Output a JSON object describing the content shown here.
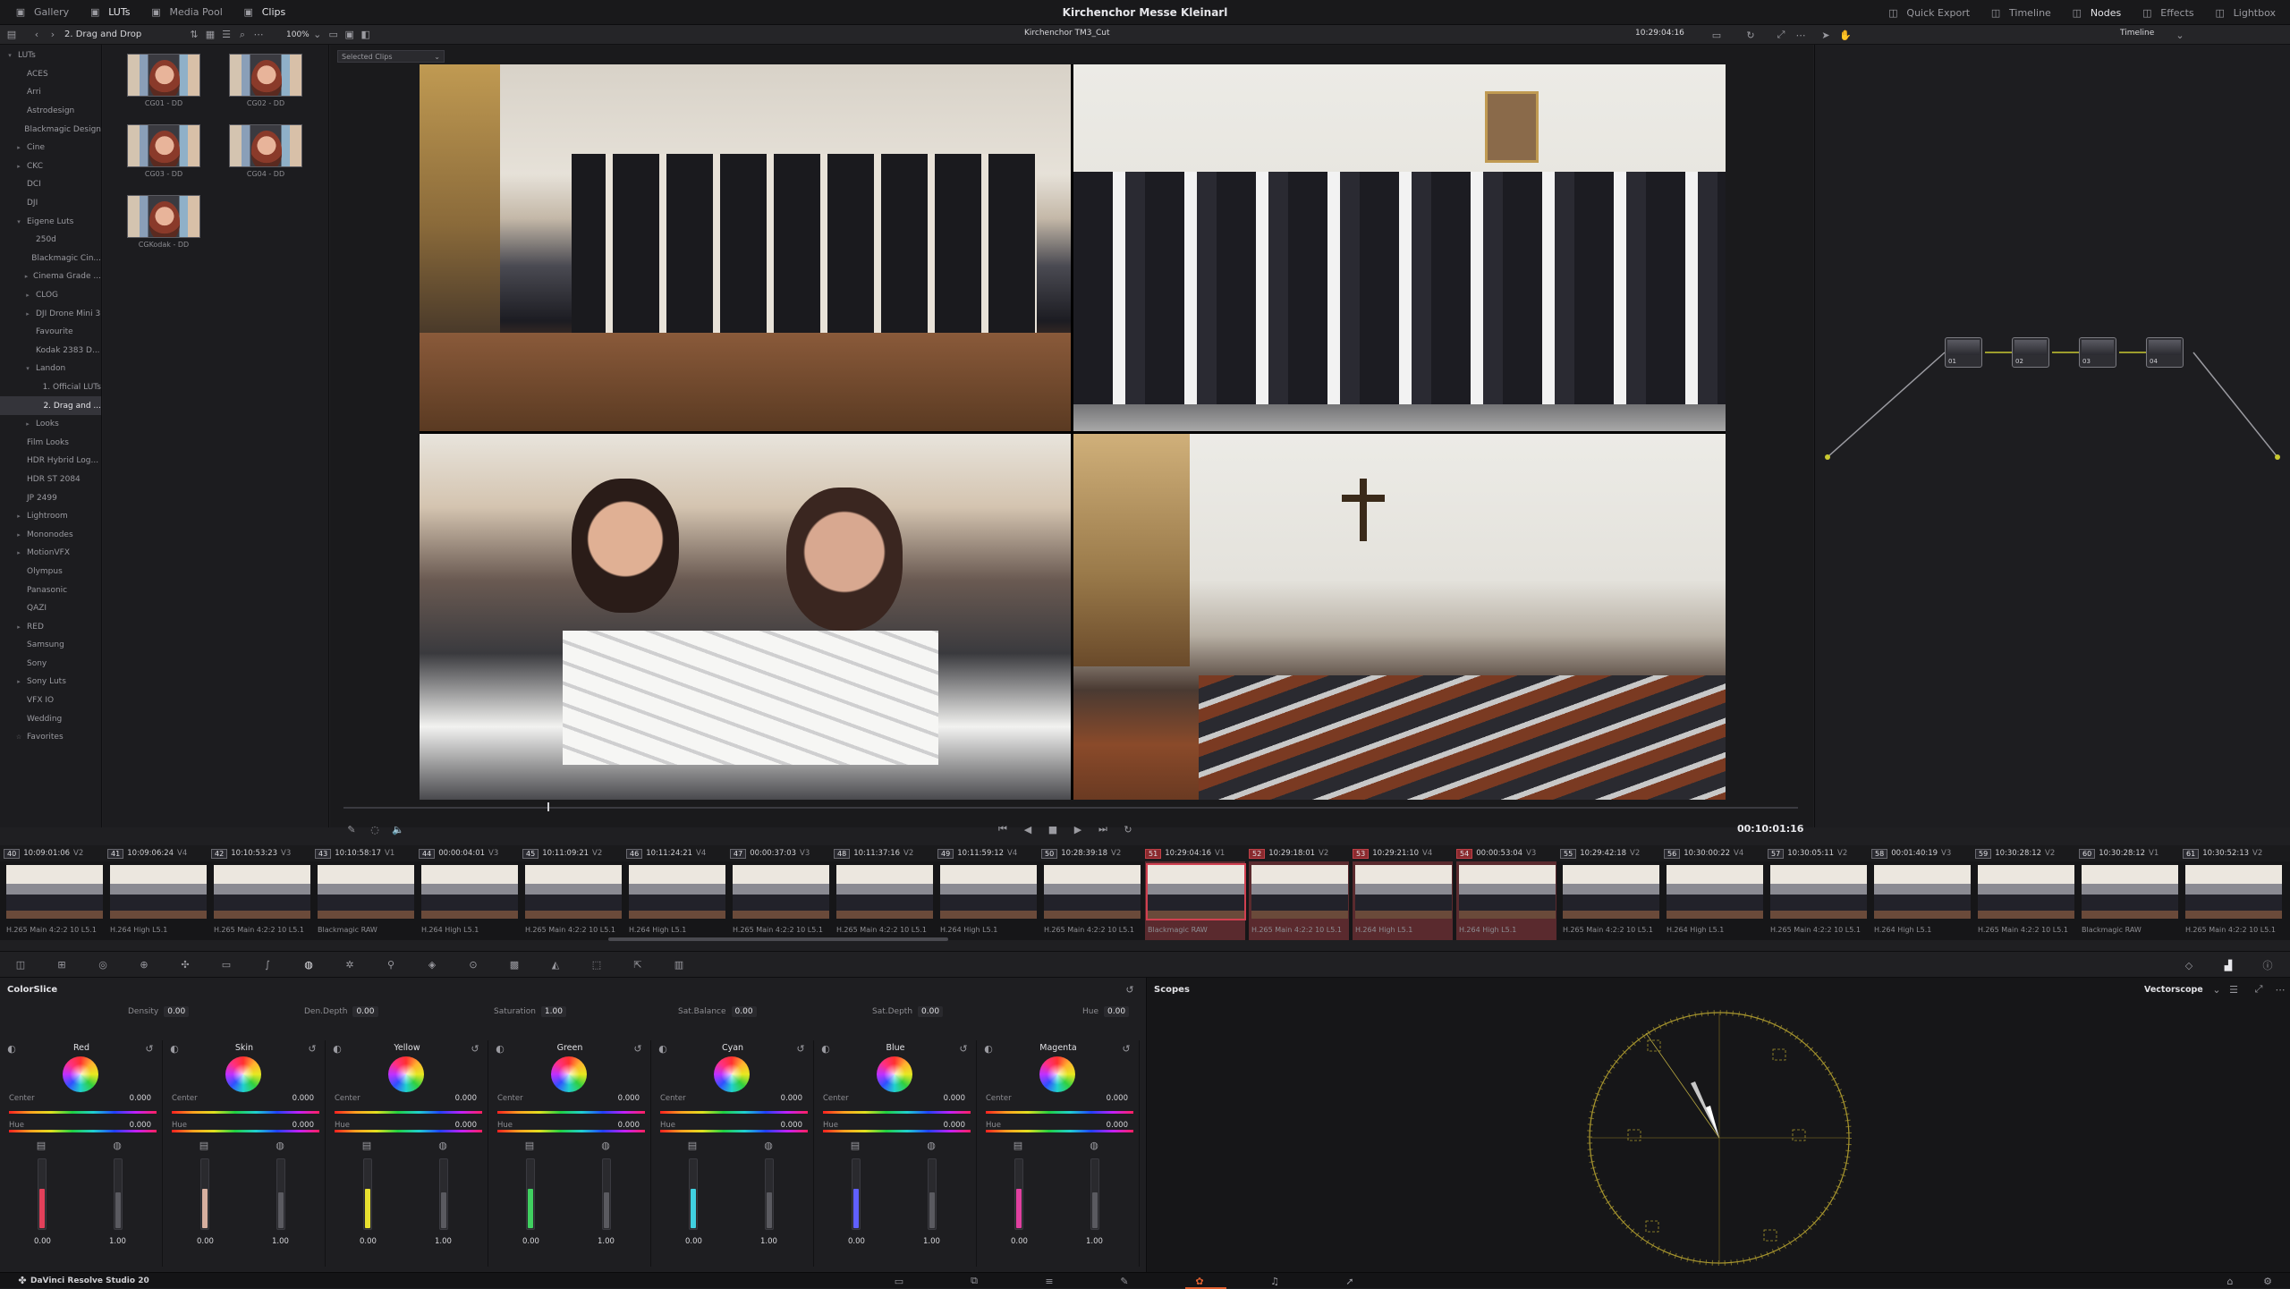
{
  "topbar": {
    "tabs": [
      {
        "label": "Gallery",
        "icon": "gallery-icon"
      },
      {
        "label": "LUTs",
        "icon": "luts-icon"
      },
      {
        "label": "Media Pool",
        "icon": "media-pool-icon"
      },
      {
        "label": "Clips",
        "icon": "clips-icon"
      }
    ],
    "project_title": "Kirchenchor Messe Kleinarl",
    "right_tabs": [
      {
        "label": "Quick Export"
      },
      {
        "label": "Timeline"
      },
      {
        "label": "Nodes"
      },
      {
        "label": "Effects"
      },
      {
        "label": "Lightbox"
      }
    ]
  },
  "toolbar2": {
    "lut_folder": "2. Drag and Drop",
    "zoom": "100%",
    "timeline_name": "Kirchenchor TM3_Cut",
    "timecode": "10:29:04:16",
    "node_mode": "Timeline",
    "selected_clips": "Selected Clips"
  },
  "sidebar": {
    "items": [
      {
        "label": "LUTs",
        "level": 0,
        "arrow": "v"
      },
      {
        "label": "ACES",
        "level": 1,
        "arrow": ""
      },
      {
        "label": "Arri",
        "level": 1,
        "arrow": ""
      },
      {
        "label": "Astrodesign",
        "level": 1,
        "arrow": ""
      },
      {
        "label": "Blackmagic Design",
        "level": 1,
        "arrow": ""
      },
      {
        "label": "Cine",
        "level": 1,
        "arrow": ">"
      },
      {
        "label": "CKC",
        "level": 1,
        "arrow": ">"
      },
      {
        "label": "DCI",
        "level": 1,
        "arrow": ""
      },
      {
        "label": "DJI",
        "level": 1,
        "arrow": ""
      },
      {
        "label": "Eigene Luts",
        "level": 1,
        "arrow": "v"
      },
      {
        "label": "250d",
        "level": 2,
        "arrow": ""
      },
      {
        "label": "Blackmagic Cin...",
        "level": 2,
        "arrow": ""
      },
      {
        "label": "Cinema Grade ...",
        "level": 2,
        "arrow": ">"
      },
      {
        "label": "CLOG",
        "level": 2,
        "arrow": ">"
      },
      {
        "label": "DJI Drone Mini 3",
        "level": 2,
        "arrow": ">"
      },
      {
        "label": "Favourite",
        "level": 2,
        "arrow": ""
      },
      {
        "label": "Kodak 2383 D...",
        "level": 2,
        "arrow": ""
      },
      {
        "label": "Landon",
        "level": 2,
        "arrow": "v"
      },
      {
        "label": "1. Official LUTs",
        "level": 3,
        "arrow": ""
      },
      {
        "label": "2. Drag and ...",
        "level": 3,
        "arrow": "",
        "selected": true
      },
      {
        "label": "Looks",
        "level": 2,
        "arrow": ">"
      },
      {
        "label": "Film Looks",
        "level": 1,
        "arrow": ""
      },
      {
        "label": "HDR Hybrid Log...",
        "level": 1,
        "arrow": ""
      },
      {
        "label": "HDR ST 2084",
        "level": 1,
        "arrow": ""
      },
      {
        "label": "JP 2499",
        "level": 1,
        "arrow": ""
      },
      {
        "label": "Lightroom",
        "level": 1,
        "arrow": ">"
      },
      {
        "label": "Mononodes",
        "level": 1,
        "arrow": ">"
      },
      {
        "label": "MotionVFX",
        "level": 1,
        "arrow": ">"
      },
      {
        "label": "Olympus",
        "level": 1,
        "arrow": ""
      },
      {
        "label": "Panasonic",
        "level": 1,
        "arrow": ""
      },
      {
        "label": "QAZI",
        "level": 1,
        "arrow": ""
      },
      {
        "label": "RED",
        "level": 1,
        "arrow": ">"
      },
      {
        "label": "Samsung",
        "level": 1,
        "arrow": ""
      },
      {
        "label": "Sony",
        "level": 1,
        "arrow": ""
      },
      {
        "label": "Sony Luts",
        "level": 1,
        "arrow": ">"
      },
      {
        "label": "VFX IO",
        "level": 1,
        "arrow": ""
      },
      {
        "label": "Wedding",
        "level": 1,
        "arrow": ""
      },
      {
        "label": "Favorites",
        "level": 1,
        "arrow": "*"
      }
    ]
  },
  "luts": [
    {
      "label": "CG01 - DD"
    },
    {
      "label": "CG02 - DD"
    },
    {
      "label": "CG03 - DD"
    },
    {
      "label": "CG04 - DD"
    },
    {
      "label": "CGKodak - DD"
    }
  ],
  "viewer": {
    "timecode": "00:10:01:16",
    "playhead_fraction": 0.14
  },
  "nodes": [
    {
      "label": "01"
    },
    {
      "label": "02"
    },
    {
      "label": "03"
    },
    {
      "label": "04"
    }
  ],
  "clips": [
    {
      "num": "40",
      "tc": "10:09:01:06",
      "track": "V2",
      "codec": "H.265 Main 4:2:2 10 L5.1"
    },
    {
      "num": "41",
      "tc": "10:09:06:24",
      "track": "V4",
      "codec": "H.264 High L5.1"
    },
    {
      "num": "42",
      "tc": "10:10:53:23",
      "track": "V3",
      "codec": "H.265 Main 4:2:2 10 L5.1"
    },
    {
      "num": "43",
      "tc": "10:10:58:17",
      "track": "V1",
      "codec": "Blackmagic RAW"
    },
    {
      "num": "44",
      "tc": "00:00:04:01",
      "track": "V3",
      "codec": "H.264 High L5.1"
    },
    {
      "num": "45",
      "tc": "10:11:09:21",
      "track": "V2",
      "codec": "H.265 Main 4:2:2 10 L5.1"
    },
    {
      "num": "46",
      "tc": "10:11:24:21",
      "track": "V4",
      "codec": "H.264 High L5.1"
    },
    {
      "num": "47",
      "tc": "00:00:37:03",
      "track": "V3",
      "codec": "H.265 Main 4:2:2 10 L5.1"
    },
    {
      "num": "48",
      "tc": "10:11:37:16",
      "track": "V2",
      "codec": "H.265 Main 4:2:2 10 L5.1"
    },
    {
      "num": "49",
      "tc": "10:11:59:12",
      "track": "V4",
      "codec": "H.264 High L5.1"
    },
    {
      "num": "50",
      "tc": "10:28:39:18",
      "track": "V2",
      "codec": "H.265 Main 4:2:2 10 L5.1"
    },
    {
      "num": "51",
      "tc": "10:29:04:16",
      "track": "V1",
      "codec": "Blackmagic RAW",
      "highlight": true
    },
    {
      "num": "52",
      "tc": "10:29:18:01",
      "track": "V2",
      "codec": "H.265 Main 4:2:2 10 L5.1",
      "highlight": true
    },
    {
      "num": "53",
      "tc": "10:29:21:10",
      "track": "V4",
      "codec": "H.264 High L5.1",
      "highlight": true
    },
    {
      "num": "54",
      "tc": "00:00:53:04",
      "track": "V3",
      "codec": "H.264 High L5.1",
      "highlight": true
    },
    {
      "num": "55",
      "tc": "10:29:42:18",
      "track": "V2",
      "codec": "H.265 Main 4:2:2 10 L5.1"
    },
    {
      "num": "56",
      "tc": "10:30:00:22",
      "track": "V4",
      "codec": "H.264 High L5.1"
    },
    {
      "num": "57",
      "tc": "10:30:05:11",
      "track": "V2",
      "codec": "H.265 Main 4:2:2 10 L5.1"
    },
    {
      "num": "58",
      "tc": "00:01:40:19",
      "track": "V3",
      "codec": "H.264 High L5.1"
    },
    {
      "num": "59",
      "tc": "10:30:28:12",
      "track": "V2",
      "codec": "H.265 Main 4:2:2 10 L5.1"
    },
    {
      "num": "60",
      "tc": "10:30:28:12",
      "track": "V1",
      "codec": "Blackmagic RAW"
    },
    {
      "num": "61",
      "tc": "10:30:52:13",
      "track": "V2",
      "codec": "H.265 Main 4:2:2 10 L5.1"
    }
  ],
  "colorslice": {
    "title": "ColorSlice",
    "globals": [
      {
        "label": "Density",
        "value": "0.00"
      },
      {
        "label": "Den.Depth",
        "value": "0.00"
      },
      {
        "label": "Saturation",
        "value": "1.00"
      },
      {
        "label": "Sat.Balance",
        "value": "0.00"
      },
      {
        "label": "Sat.Depth",
        "value": "0.00"
      },
      {
        "label": "Hue",
        "value": "0.00"
      }
    ],
    "center_label": "Center",
    "hue_label": "Hue",
    "columns": [
      {
        "name": "Red",
        "center": "0.000",
        "hue": "0.000",
        "left": "0.00",
        "right": "1.00",
        "color": "#e2405a"
      },
      {
        "name": "Skin",
        "center": "0.000",
        "hue": "0.000",
        "left": "0.00",
        "right": "1.00",
        "color": "#d8b0a0"
      },
      {
        "name": "Yellow",
        "center": "0.000",
        "hue": "0.000",
        "left": "0.00",
        "right": "1.00",
        "color": "#e8e030"
      },
      {
        "name": "Green",
        "center": "0.000",
        "hue": "0.000",
        "left": "0.00",
        "right": "1.00",
        "color": "#40d060"
      },
      {
        "name": "Cyan",
        "center": "0.000",
        "hue": "0.000",
        "left": "0.00",
        "right": "1.00",
        "color": "#40d0e0"
      },
      {
        "name": "Blue",
        "center": "0.000",
        "hue": "0.000",
        "left": "0.00",
        "right": "1.00",
        "color": "#6060ff"
      },
      {
        "name": "Magenta",
        "center": "0.000",
        "hue": "0.000",
        "left": "0.00",
        "right": "1.00",
        "color": "#e040a0"
      }
    ]
  },
  "scopes": {
    "title": "Scopes",
    "mode": "Vectorscope"
  },
  "statusbar": {
    "app": "DaVinci Resolve Studio 20"
  }
}
